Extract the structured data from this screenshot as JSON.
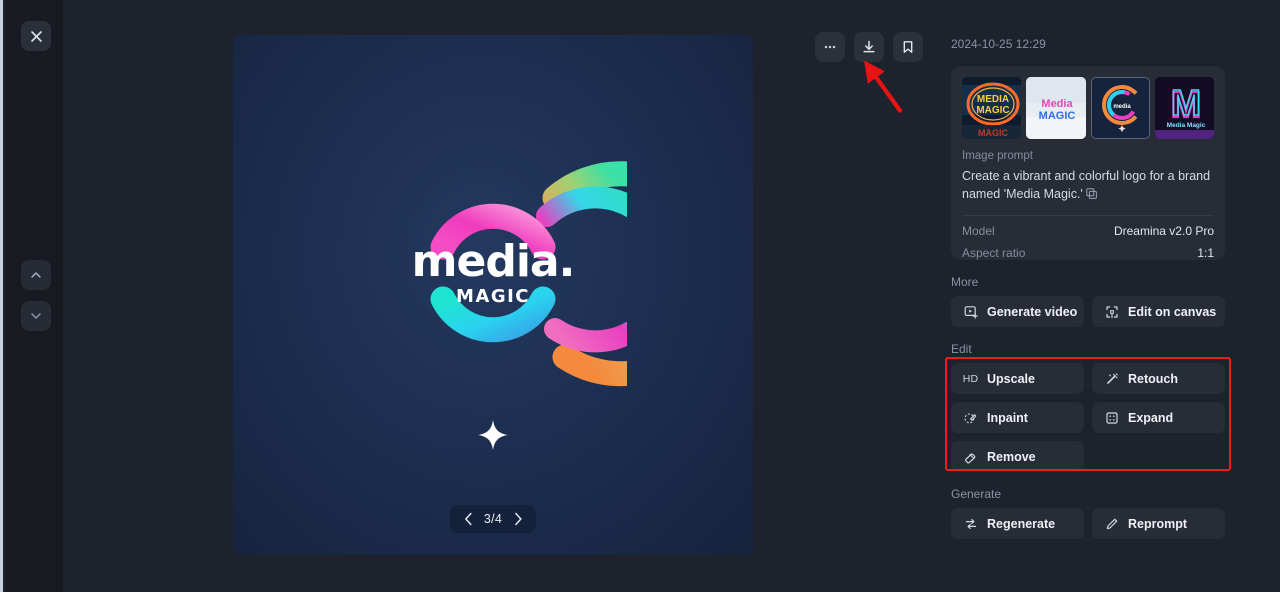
{
  "rail": {
    "close_icon": "close-icon",
    "up_icon": "chevron-up-icon",
    "down_icon": "chevron-down-icon"
  },
  "toolbar": {
    "more_label": "•••",
    "more_icon": "more-horizontal-icon",
    "download_icon": "download-icon",
    "bookmark_icon": "bookmark-icon"
  },
  "viewer": {
    "pager_current": "3/4",
    "prev_icon": "chevron-left-icon",
    "next_icon": "chevron-right-icon",
    "logo_word": "media",
    "logo_dot": ".",
    "logo_sub": "MAGIC",
    "canvas_bg": "#1c2d4e"
  },
  "annotation": {
    "arrow_color": "#e81313",
    "highlight_color": "#f21b1b"
  },
  "details": {
    "timestamp": "2024-10-25 12:29",
    "thumbnails": [
      {
        "name": "thumbnail-neon-sign",
        "selected": false
      },
      {
        "name": "thumbnail-3d-text",
        "selected": false
      },
      {
        "name": "thumbnail-circle-logo",
        "selected": true
      },
      {
        "name": "thumbnail-neon-m",
        "selected": false
      }
    ],
    "prompt_label": "Image prompt",
    "prompt_text": "Create a vibrant and colorful logo for a brand named 'Media Magic.'",
    "copy_icon": "copy-icon",
    "meta": [
      {
        "key": "Model",
        "value": "Dreamina v2.0 Pro"
      },
      {
        "key": "Aspect ratio",
        "value": "1:1"
      }
    ]
  },
  "sections": {
    "more": {
      "title": "More",
      "buttons": [
        {
          "label": "Generate video",
          "icon": "video-frame-icon"
        },
        {
          "label": "Edit on canvas",
          "icon": "crop-frame-icon"
        }
      ]
    },
    "edit": {
      "title": "Edit",
      "buttons": [
        {
          "label": "Upscale",
          "icon": "hd-icon"
        },
        {
          "label": "Retouch",
          "icon": "magic-wand-icon"
        },
        {
          "label": "Inpaint",
          "icon": "brush-icon"
        },
        {
          "label": "Expand",
          "icon": "expand-icon"
        },
        {
          "label": "Remove",
          "icon": "eraser-icon"
        }
      ]
    },
    "generate": {
      "title": "Generate",
      "buttons": [
        {
          "label": "Regenerate",
          "icon": "refresh-icon"
        },
        {
          "label": "Reprompt",
          "icon": "pencil-icon"
        }
      ]
    }
  }
}
